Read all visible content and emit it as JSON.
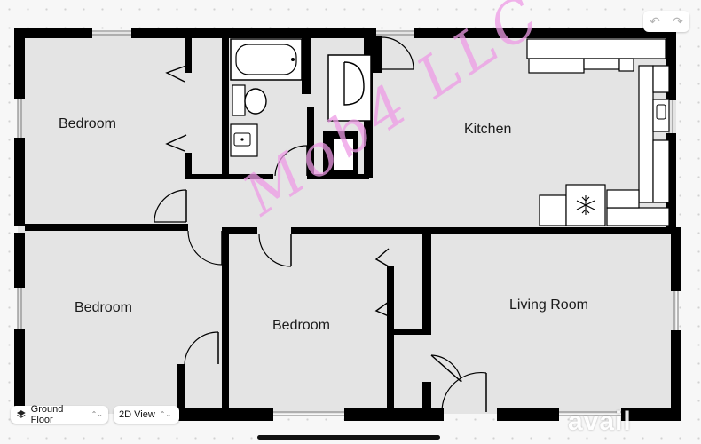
{
  "rooms": {
    "bedroom_top_left": "Bedroom",
    "kitchen": "Kitchen",
    "bedroom_bottom_left": "Bedroom",
    "bedroom_center": "Bedroom",
    "living_room": "Living Room"
  },
  "toolbar": {
    "floor_selector": "Ground Floor",
    "view_selector": "2D View",
    "chevron": "⌃⌄"
  },
  "icons": {
    "undo": "↶",
    "redo": "↷",
    "layers": "layers-icon",
    "snowflake": "snowflake-icon"
  },
  "watermark": {
    "text": "Mob4 LLC",
    "color": "#ee9be6"
  },
  "logo": {
    "text": "avail"
  },
  "colors": {
    "wall": "#000000",
    "floor": "#e4e4e4",
    "background": "#f7f7f7"
  }
}
